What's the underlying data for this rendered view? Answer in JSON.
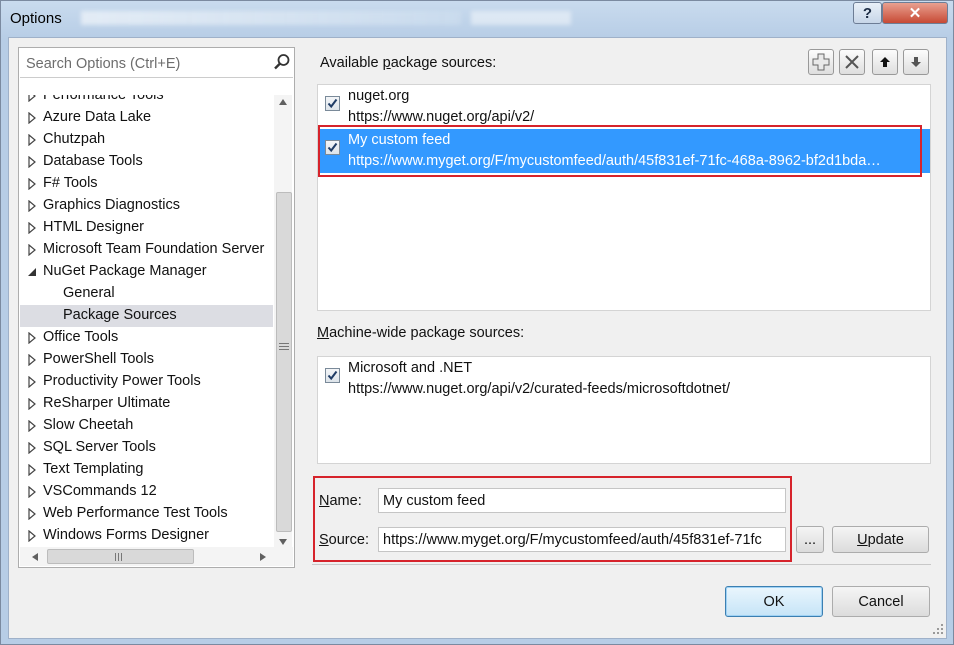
{
  "window": {
    "title": "Options",
    "help_label": "?",
    "close_label": "✕"
  },
  "search": {
    "placeholder": "Search Options (Ctrl+E)"
  },
  "tree": {
    "items": [
      {
        "label": "Performance Tools",
        "expanded": false,
        "selected": false,
        "level": 0
      },
      {
        "label": "Azure Data Lake",
        "expanded": false,
        "selected": false,
        "level": 0
      },
      {
        "label": "Chutzpah",
        "expanded": false,
        "selected": false,
        "level": 0
      },
      {
        "label": "Database Tools",
        "expanded": false,
        "selected": false,
        "level": 0
      },
      {
        "label": "F# Tools",
        "expanded": false,
        "selected": false,
        "level": 0
      },
      {
        "label": "Graphics Diagnostics",
        "expanded": false,
        "selected": false,
        "level": 0
      },
      {
        "label": "HTML Designer",
        "expanded": false,
        "selected": false,
        "level": 0
      },
      {
        "label": "Microsoft Team Foundation Server",
        "expanded": false,
        "selected": false,
        "level": 0
      },
      {
        "label": "NuGet Package Manager",
        "expanded": true,
        "selected": false,
        "level": 0
      },
      {
        "label": "General",
        "expanded": null,
        "selected": false,
        "level": 1
      },
      {
        "label": "Package Sources",
        "expanded": null,
        "selected": true,
        "level": 1
      },
      {
        "label": "Office Tools",
        "expanded": false,
        "selected": false,
        "level": 0
      },
      {
        "label": "PowerShell Tools",
        "expanded": false,
        "selected": false,
        "level": 0
      },
      {
        "label": "Productivity Power Tools",
        "expanded": false,
        "selected": false,
        "level": 0
      },
      {
        "label": "ReSharper Ultimate",
        "expanded": false,
        "selected": false,
        "level": 0
      },
      {
        "label": "Slow Cheetah",
        "expanded": false,
        "selected": false,
        "level": 0
      },
      {
        "label": "SQL Server Tools",
        "expanded": false,
        "selected": false,
        "level": 0
      },
      {
        "label": "Text Templating",
        "expanded": false,
        "selected": false,
        "level": 0
      },
      {
        "label": "VSCommands 12",
        "expanded": false,
        "selected": false,
        "level": 0
      },
      {
        "label": "Web Performance Test Tools",
        "expanded": false,
        "selected": false,
        "level": 0
      },
      {
        "label": "Windows Forms Designer",
        "expanded": false,
        "selected": false,
        "level": 0
      }
    ]
  },
  "available": {
    "label_prefix": "Available ",
    "label_accel": "p",
    "label_suffix": "ackage sources:",
    "sources": [
      {
        "name": "nuget.org",
        "url": "https://www.nuget.org/api/v2/",
        "checked": true,
        "selected": false
      },
      {
        "name": "My custom feed",
        "url": "https://www.myget.org/F/mycustomfeed/auth/45f831ef-71fc-468a-8962-bf2d1bda…",
        "checked": true,
        "selected": true
      }
    ]
  },
  "machine_wide": {
    "label_accel": "M",
    "label_rest": "achine-wide package sources:",
    "sources": [
      {
        "name": "Microsoft and .NET",
        "url": "https://www.nuget.org/api/v2/curated-feeds/microsoftdotnet/",
        "checked": true
      }
    ]
  },
  "form": {
    "name_accel": "N",
    "name_rest": "ame:",
    "name_value": "My custom feed",
    "source_accel": "S",
    "source_rest": "ource:",
    "source_value": "https://www.myget.org/F/mycustomfeed/auth/45f831ef-71fc",
    "browse_label": "...",
    "update_accel": "U",
    "update_rest": "pdate"
  },
  "footer": {
    "ok_label": "OK",
    "cancel_label": "Cancel"
  },
  "colors": {
    "selection": "#3399ff",
    "highlight_box": "#d6232b",
    "tree_selected": "#dcdde3"
  }
}
